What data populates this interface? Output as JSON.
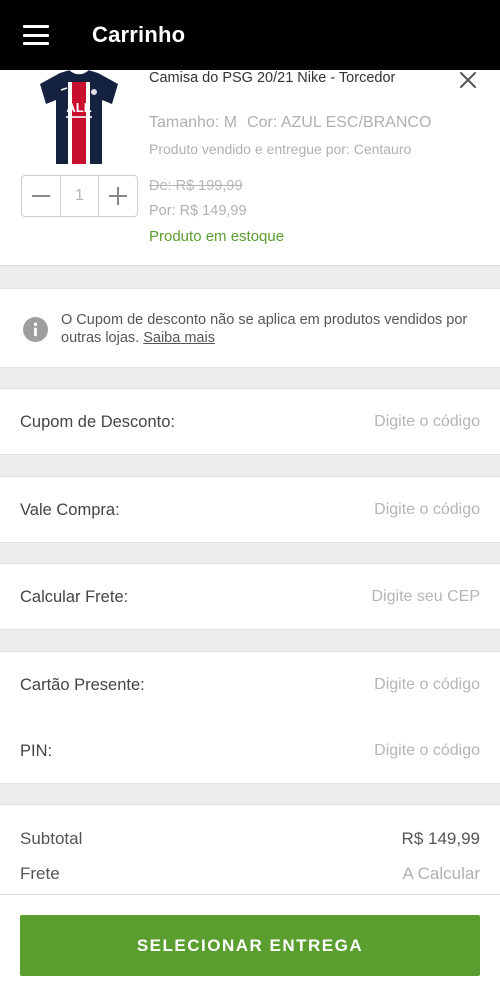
{
  "header": {
    "title": "Carrinho",
    "menu_icon": "hamburger-menu-icon"
  },
  "product": {
    "name": "Camisa do PSG 20/21 Nike - Torcedor",
    "size": "Tamanho: M",
    "color": "Cor: AZUL ESC/BRANCO",
    "seller": "Produto vendido e entregue por: Centauro",
    "price_old": "De: R$ 199,99",
    "price_new": "Por: R$ 149,99",
    "stock": "Produto em estoque",
    "quantity": "1",
    "remove_icon": "close-icon",
    "colors": {
      "shirt_navy": "#14213f",
      "shirt_red": "#c8102e"
    }
  },
  "coupon_notice": {
    "text": "O Cupom de desconto não se aplica em produtos vendidos por outras lojas.",
    "link": "Saiba mais",
    "icon": "info-icon"
  },
  "fields": {
    "coupon": {
      "label": "Cupom de Desconto:",
      "placeholder": "Digite o código"
    },
    "vale": {
      "label": "Vale Compra:",
      "placeholder": "Digite o código"
    },
    "frete": {
      "label": "Calcular Frete:",
      "placeholder": "Digite seu CEP"
    },
    "gift_card": {
      "label": "Cartão Presente:",
      "placeholder": "Digite o código"
    },
    "pin": {
      "label": "PIN:",
      "placeholder": "Digite o código"
    }
  },
  "summary": {
    "subtotal_label": "Subtotal",
    "subtotal_value": "R$ 149,99",
    "frete_label": "Frete",
    "frete_value": "A Calcular"
  },
  "cta": {
    "label": "SELECIONAR ENTREGA"
  },
  "colors": {
    "accent": "#5a9e2f",
    "header_bg": "#000000",
    "muted_text": "#b0b0b0"
  }
}
